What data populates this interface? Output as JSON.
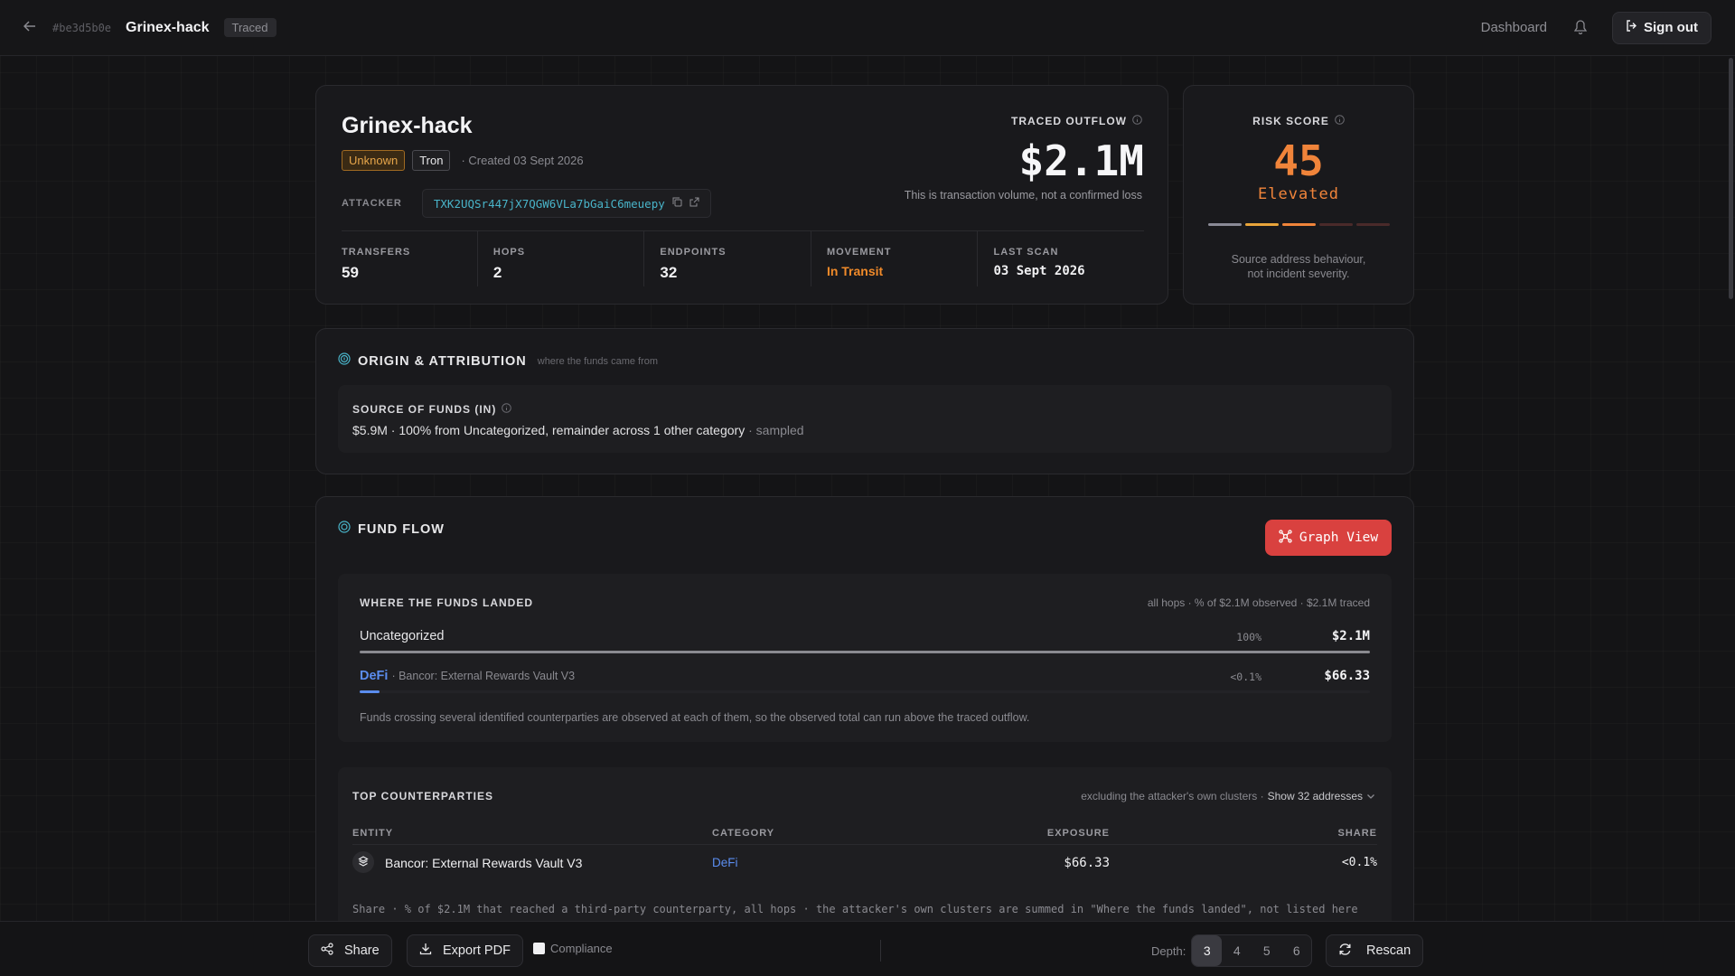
{
  "header": {
    "case_id": "#be3d5b0e",
    "title": "Grinex-hack",
    "status_badge": "Traced",
    "nav_dashboard": "Dashboard",
    "signout_label": "Sign out"
  },
  "summary": {
    "title": "Grinex-hack",
    "tag_risk": "Unknown",
    "tag_chain": "Tron",
    "created": "Created 03 Sept 2026",
    "attacker_label": "ATTACKER",
    "attacker_address": "TXK2UQSr447jX7QGW6VLa7bGaiC6meuepy",
    "outflow_label": "TRACED OUTFLOW",
    "outflow_value": "$2.1M",
    "outflow_note": "This is transaction volume, not a confirmed loss",
    "stats": [
      {
        "label": "TRANSFERS",
        "value": "59"
      },
      {
        "label": "HOPS",
        "value": "2"
      },
      {
        "label": "ENDPOINTS",
        "value": "32"
      },
      {
        "label": "MOVEMENT",
        "value": "In Transit"
      },
      {
        "label": "LAST SCAN",
        "value": "03 Sept 2026"
      }
    ]
  },
  "risk": {
    "label": "RISK SCORE",
    "score": "45",
    "level": "Elevated",
    "note_line1": "Source address behaviour,",
    "note_line2": "not incident severity.",
    "bar_colors": [
      "#8a8a96",
      "#e8a43a",
      "#f0843a",
      "#4a2a2a",
      "#4a2a2a"
    ]
  },
  "origin": {
    "title": "ORIGIN & ATTRIBUTION",
    "subtitle": "where the funds came from",
    "source_label": "SOURCE OF FUNDS (IN)",
    "source_text": "$5.9M · 100% from Uncategorized, remainder across 1 other category",
    "source_suffix": "· sampled"
  },
  "fund_flow": {
    "title": "FUND FLOW",
    "graph_button": "Graph View",
    "landed": {
      "title": "WHERE THE FUNDS LANDED",
      "meta": "all hops · % of $2.1M observed · $2.1M traced",
      "rows": [
        {
          "name": "Uncategorized",
          "detail": "",
          "pct": "100%",
          "amount": "$2.1M",
          "share": 1.0,
          "color": "#8a8a90"
        },
        {
          "name": "DeFi",
          "detail": "· Bancor: External Rewards Vault V3",
          "pct": "<0.1%",
          "amount": "$66.33",
          "share": 0.02,
          "color": "#5b8def"
        }
      ],
      "note": "Funds crossing several identified counterparties are observed at each of them, so the observed total can run above the traced outflow."
    },
    "counterparties": {
      "title": "TOP COUNTERPARTIES",
      "meta": "excluding the attacker's own clusters ·",
      "show_label": "Show 32 addresses",
      "columns": [
        "ENTITY",
        "CATEGORY",
        "EXPOSURE",
        "SHARE"
      ],
      "rows": [
        {
          "entity": "Bancor: External Rewards Vault V3",
          "category": "DeFi",
          "exposure": "$66.33",
          "share": "<0.1%"
        }
      ],
      "note": "Share · % of $2.1M that reached a third-party counterparty, all hops · the attacker's own clusters are summed in \"Where the funds landed\", not listed here"
    }
  },
  "bottom": {
    "share_label": "Share",
    "export_label": "Export PDF",
    "compliance_label": "Compliance",
    "depth_label": "Depth:",
    "depth_options": [
      "3",
      "4",
      "5",
      "6"
    ],
    "depth_selected": "3",
    "rescan_label": "Rescan"
  }
}
